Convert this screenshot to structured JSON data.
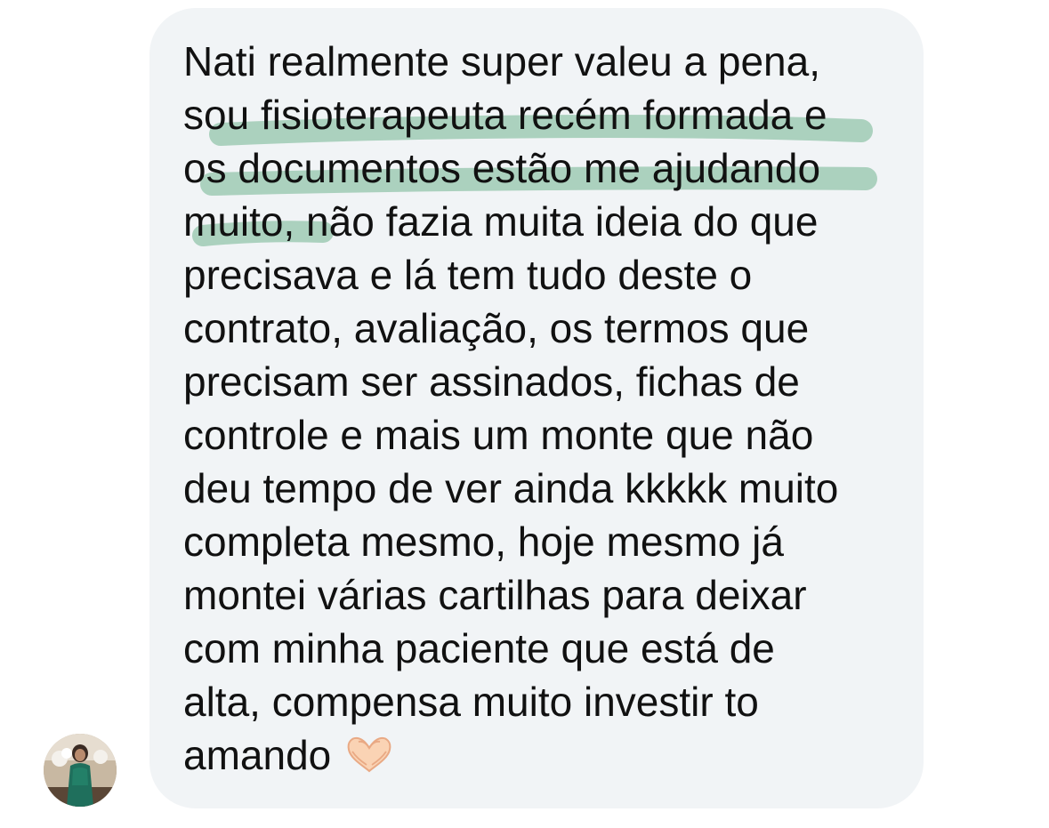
{
  "conversation": {
    "message": {
      "lines": [
        "Nati realmente super valeu a pena,",
        "sou fisioterapeuta recém formada e",
        "os documentos estão me ajudando",
        "muito, não fazia muita ideia do que",
        "precisava e lá tem tudo deste o",
        "contrato, avaliação, os termos que",
        "precisam ser assinados, fichas de",
        "controle e mais um monte que não",
        "deu tempo de ver ainda kkkkk muito",
        "completa mesmo, hoje mesmo já",
        "montei várias cartilhas para deixar",
        "com minha paciente que está de",
        "alta, compensa muito investir to",
        "amando"
      ],
      "emoji": "heart-hands-emoji"
    },
    "avatar": "contact-avatar",
    "colors": {
      "bubble": "#f1f4f6",
      "text": "#111111",
      "highlight": "#9fcab4"
    }
  }
}
